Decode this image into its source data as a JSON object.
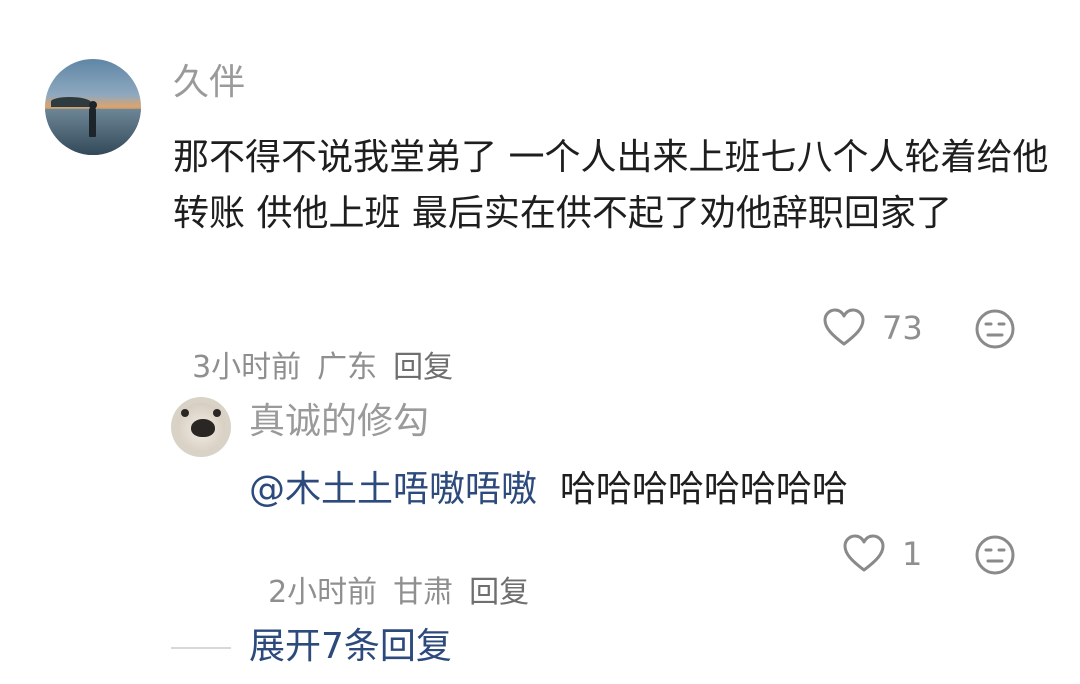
{
  "comment": {
    "username": "久伴",
    "content": "那不得不说我堂弟了 一个人出来上班七八个人轮着给他转账 供他上班 最后实在供不起了劝他辞职回家了",
    "time": "3小时前",
    "location": "广东",
    "reply_label": "回复",
    "likes": "73",
    "avatar_icon": "sunset-beach-avatar",
    "like_icon": "heart-outline-icon",
    "emoji_icon": "neutral-face-icon"
  },
  "reply": {
    "username": "真诚的修勾",
    "mention": "@木土土唔嗷唔嗷",
    "content": "哈哈哈哈哈哈哈哈",
    "time": "2小时前",
    "location": "甘肃",
    "reply_label": "回复",
    "likes": "1",
    "avatar_icon": "dog-face-avatar",
    "like_icon": "heart-outline-icon",
    "emoji_icon": "neutral-face-icon"
  },
  "expand": {
    "label": "展开7条回复"
  },
  "colors": {
    "mention": "#2d4a7c",
    "username": "#9a9a9a",
    "text": "#1e1e1e",
    "meta": "#8f8f8f"
  }
}
